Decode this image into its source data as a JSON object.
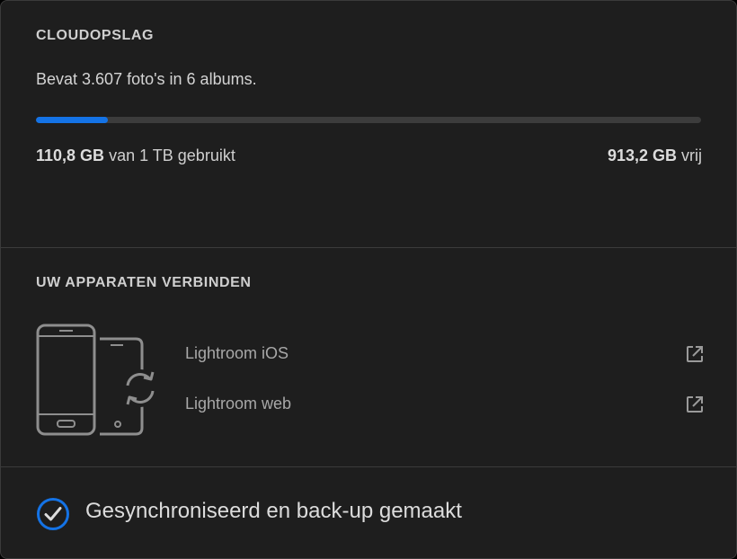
{
  "cloud_storage": {
    "heading": "CLOUDOPSLAG",
    "summary": "Bevat 3.607 foto's in 6 albums.",
    "used_amount": "110,8 GB",
    "used_suffix": "van 1 TB gebruikt",
    "free_amount": "913,2 GB",
    "free_suffix": "vrij",
    "progress_fraction": 0.108,
    "progress_color": "#1473e6"
  },
  "devices": {
    "heading": "UW APPARATEN VERBINDEN",
    "illustration_icon": "phone-tablet-sync-icon",
    "links": [
      {
        "label": "Lightroom iOS",
        "icon": "external-link-icon"
      },
      {
        "label": "Lightroom web",
        "icon": "external-link-icon"
      }
    ]
  },
  "sync": {
    "status_icon": "check-circle-icon",
    "status_text": "Gesynchroniseerd en back-up gemaakt",
    "accent_color": "#1473e6"
  }
}
